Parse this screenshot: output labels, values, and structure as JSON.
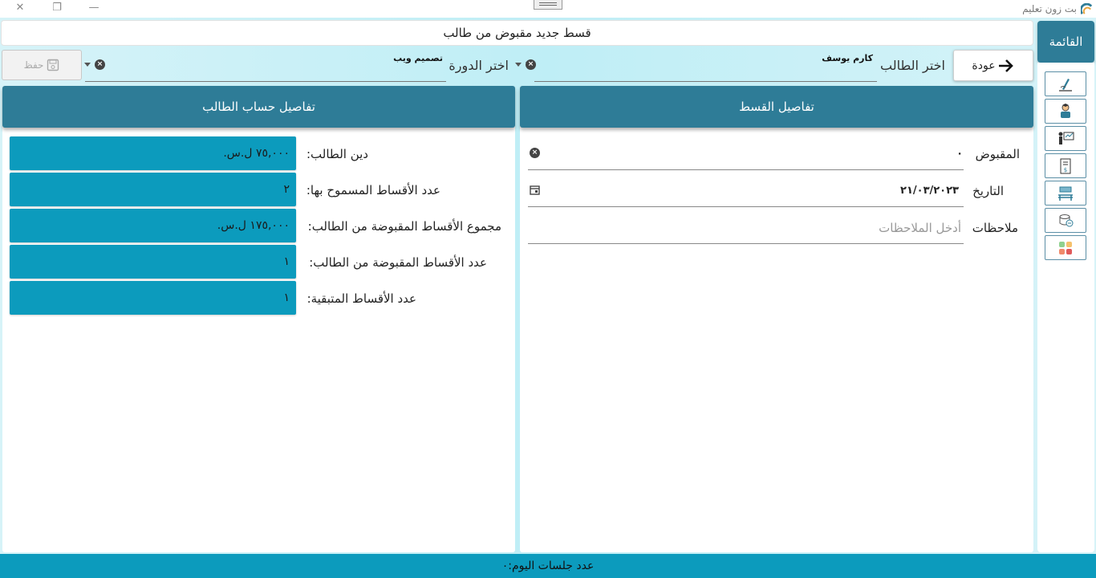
{
  "window": {
    "app_title": "بت زون تعليم",
    "close_glyph": "✕",
    "restore_glyph": "❐",
    "minimize_glyph": "—"
  },
  "header": {
    "title": "قسط جديد مقبوض من طالب"
  },
  "menu": {
    "label": "القائمة",
    "items": [
      "teacher-icon",
      "student-icon",
      "classroom-icon",
      "invoice-icon",
      "seats-icon",
      "payment-icon",
      "apps-icon"
    ]
  },
  "toolbar": {
    "back_label": "عودة",
    "student_select": {
      "label": "اختر الطالب",
      "value": "كارم يوسف"
    },
    "course_select": {
      "label": "اختر الدورة",
      "value": "تصميم ويب"
    },
    "save_label": "حفظ"
  },
  "installment": {
    "title": "تفاصيل القسط",
    "fields": [
      {
        "label": "المقبوض",
        "value": "٠"
      },
      {
        "label": "التاريخ",
        "value": "٢١/٠٣/٢٠٢٣"
      },
      {
        "label": "ملاحظات",
        "placeholder": "أدخل الملاحظات"
      }
    ]
  },
  "account": {
    "title": "تفاصيل حساب الطالب",
    "rows": [
      {
        "label": "دين الطالب:",
        "value": "٧٥,٠٠٠ ل.س."
      },
      {
        "label": "عدد الأقساط المسموح بها:",
        "value": "٢"
      },
      {
        "label": "مجموع الأقساط المقبوضة من الطالب:",
        "value": "١٧٥,٠٠٠ ل.س."
      },
      {
        "label": "عدد الأقساط المقبوضة من الطالب:",
        "value": "١"
      },
      {
        "label": "عدد الأقساط المتبقية:",
        "value": "١"
      }
    ]
  },
  "footer": {
    "sessions_today": "عدد جلسات اليوم:٠"
  },
  "colors": {
    "accent": "#2e7c97",
    "value_box": "#0c9bbd",
    "background": "#c8f0f7"
  }
}
